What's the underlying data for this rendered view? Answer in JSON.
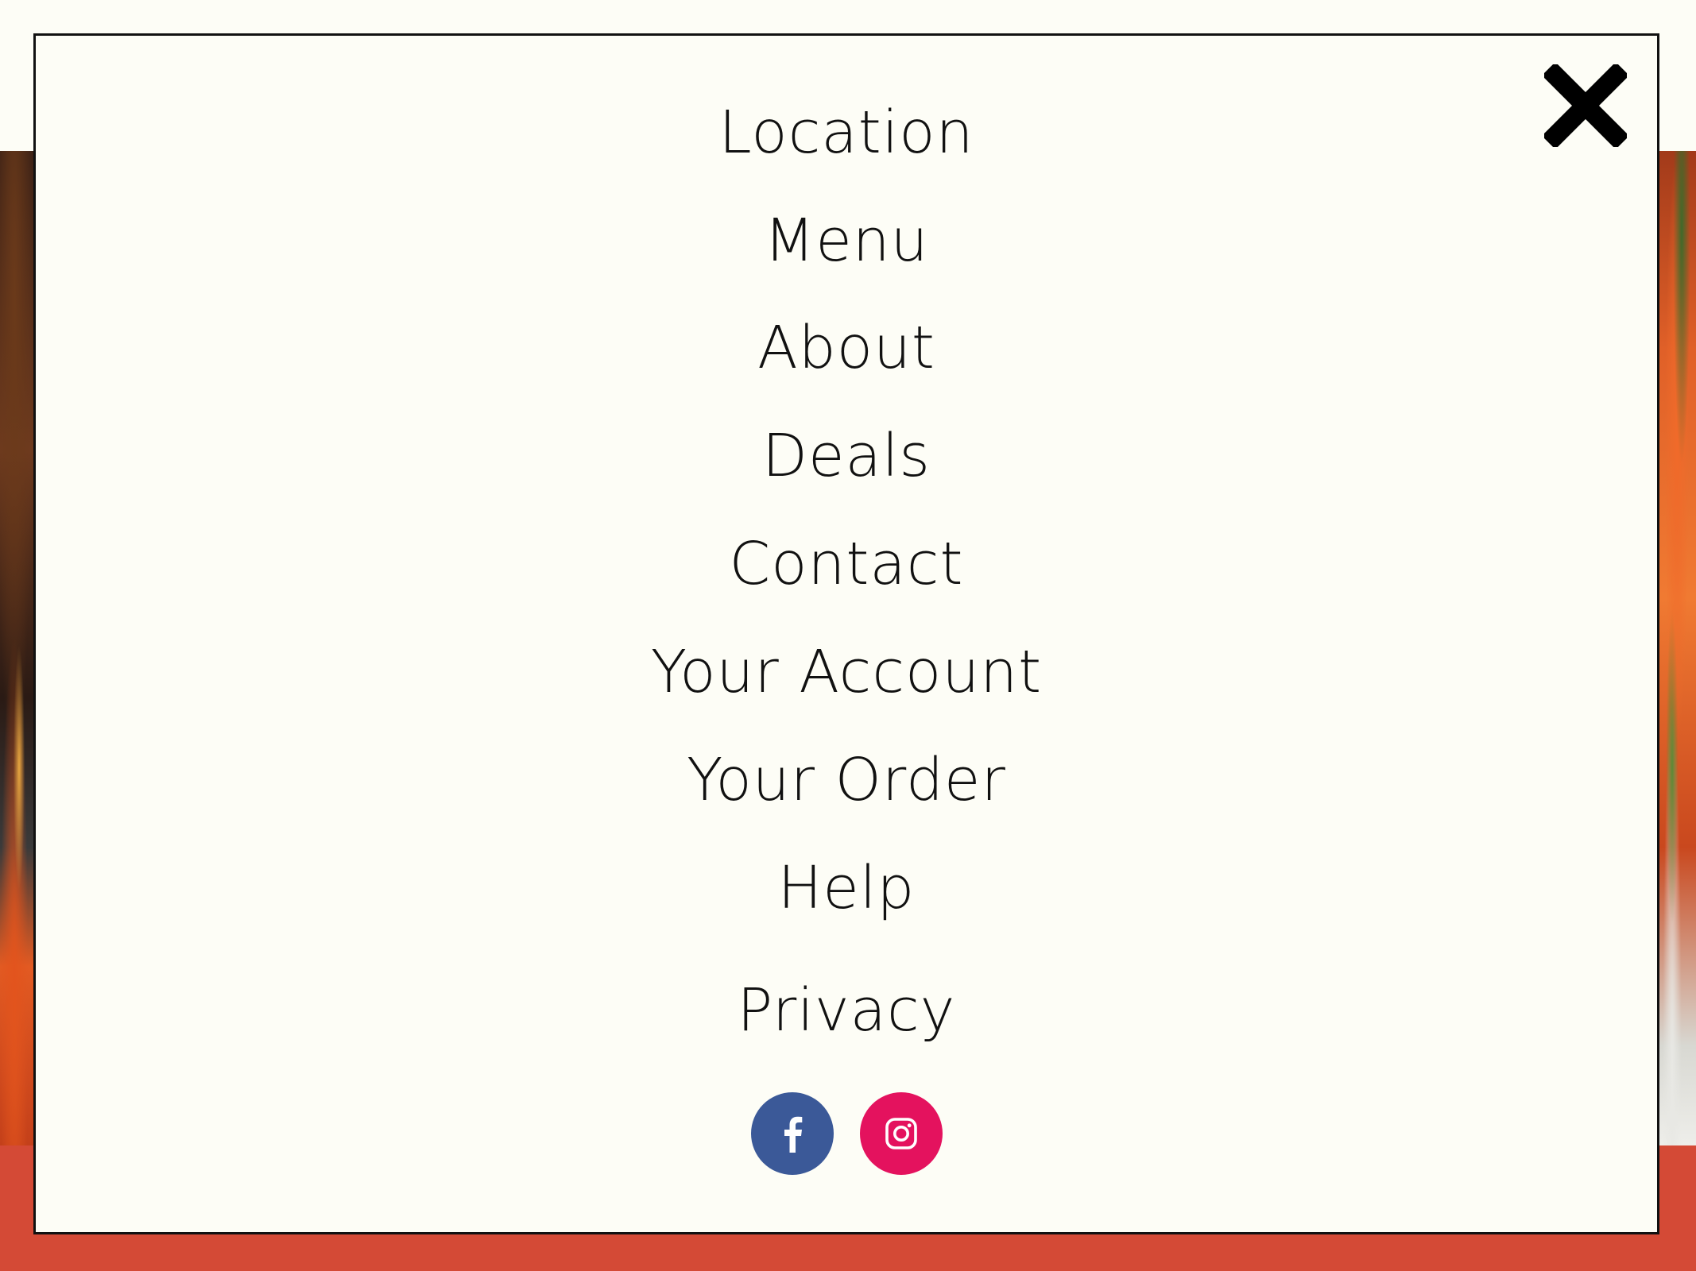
{
  "menu": {
    "items": [
      {
        "label": "Location"
      },
      {
        "label": "Menu"
      },
      {
        "label": "About"
      },
      {
        "label": "Deals"
      },
      {
        "label": "Contact"
      },
      {
        "label": "Your Account"
      },
      {
        "label": "Your Order"
      },
      {
        "label": "Help"
      },
      {
        "label": "Privacy"
      }
    ]
  },
  "icons": {
    "close": "close-icon",
    "facebook": "facebook-icon",
    "instagram": "instagram-icon"
  },
  "colors": {
    "modal_background": "#fdfdf6",
    "modal_border": "#111111",
    "text": "#111111",
    "footer_band": "#d44a36",
    "facebook": "#3b5998",
    "instagram": "#e4125e"
  }
}
